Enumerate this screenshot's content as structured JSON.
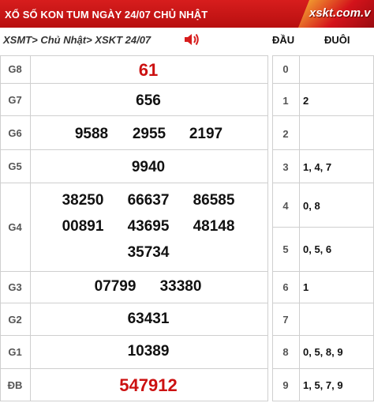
{
  "header": {
    "title": "XỔ SỐ KON TUM NGÀY 24/07 CHỦ NHẬT",
    "logo": "xskt.com.v"
  },
  "breadcrumb": {
    "item1": "XSMT",
    "item2": "Chủ Nhật",
    "item3": "XSKT 24/07",
    "separator": ">"
  },
  "columns": {
    "dau": "ĐẦU",
    "duoi": "ĐUÔI"
  },
  "prizes": [
    {
      "label": "G8",
      "numbers": [
        "61"
      ]
    },
    {
      "label": "G7",
      "numbers": [
        "656"
      ]
    },
    {
      "label": "G6",
      "numbers": [
        "9588",
        "2955",
        "2197"
      ]
    },
    {
      "label": "G5",
      "numbers": [
        "9940"
      ]
    },
    {
      "label": "G4",
      "numbers": [
        "38250",
        "66637",
        "86585",
        "00891",
        "43695",
        "48148",
        "35734"
      ]
    },
    {
      "label": "G3",
      "numbers": [
        "07799",
        "33380"
      ]
    },
    {
      "label": "G2",
      "numbers": [
        "63431"
      ]
    },
    {
      "label": "G1",
      "numbers": [
        "10389"
      ]
    },
    {
      "label": "ĐB",
      "numbers": [
        "547912"
      ]
    }
  ],
  "loto": [
    {
      "dau": "0",
      "duoi": ""
    },
    {
      "dau": "1",
      "duoi": "2"
    },
    {
      "dau": "2",
      "duoi": ""
    },
    {
      "dau": "3",
      "duoi": "1, 4, 7"
    },
    {
      "dau": "4",
      "duoi": "0, 8"
    },
    {
      "dau": "5",
      "duoi": "0, 5, 6"
    },
    {
      "dau": "6",
      "duoi": "1"
    },
    {
      "dau": "7",
      "duoi": ""
    },
    {
      "dau": "8",
      "duoi": "0, 5, 8, 9"
    },
    {
      "dau": "9",
      "duoi": "1, 5, 7, 9"
    }
  ],
  "colors": {
    "header_bg": "#c8161c",
    "highlight": "#cc1111",
    "grid": "#cfcfcf"
  },
  "icons": {
    "speaker": "speaker-icon"
  }
}
